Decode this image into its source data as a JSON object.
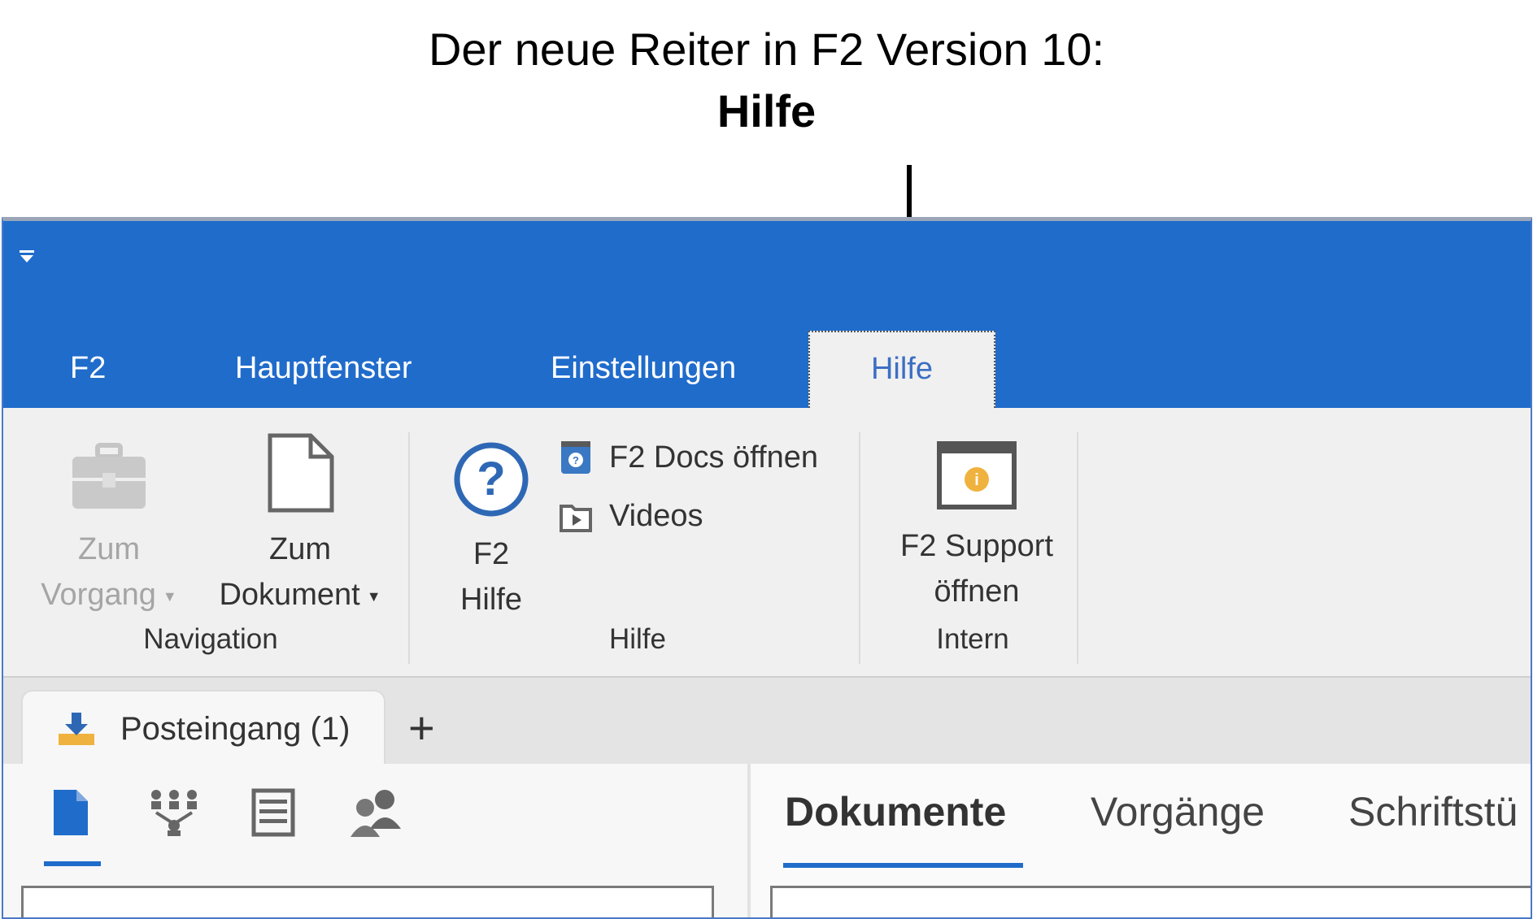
{
  "caption": {
    "line1": "Der neue Reiter in F2 Version 10:",
    "line2": "Hilfe"
  },
  "menu_tabs": [
    {
      "label": "F2"
    },
    {
      "label": "Hauptfenster"
    },
    {
      "label": "Einstellungen"
    },
    {
      "label": "Hilfe",
      "active": true
    }
  ],
  "ribbon": {
    "navigation": {
      "group_label": "Navigation",
      "zum_vorgang": {
        "line1": "Zum",
        "line2": "Vorgang"
      },
      "zum_dokument": {
        "line1": "Zum",
        "line2": "Dokument"
      }
    },
    "hilfe": {
      "group_label": "Hilfe",
      "f2_hilfe": {
        "line1": "F2",
        "line2": "Hilfe"
      },
      "docs": "F2 Docs öffnen",
      "videos": "Videos"
    },
    "intern": {
      "group_label": "Intern",
      "support": {
        "line1": "F2 Support",
        "line2": "öffnen"
      }
    }
  },
  "doc_tabs": {
    "inbox": "Posteingang (1)",
    "add": "+"
  },
  "right_tabs": [
    "Dokumente",
    "Vorgänge",
    "Schriftstü"
  ],
  "colors": {
    "titlebar": "#206ccb",
    "accent": "#206ccb",
    "active_tab_text": "#3c6fc4",
    "inbox_icon": "#f0b23e"
  },
  "icons": {
    "quick_access": "dropdown-arrow-icon",
    "zum_vorgang": "briefcase-icon",
    "zum_dokument": "document-icon",
    "f2_hilfe": "question-circle-icon",
    "docs": "help-book-icon",
    "videos": "video-folder-icon",
    "support": "info-window-icon",
    "inbox": "inbox-download-icon",
    "left_tabs": [
      "document-icon",
      "org-chart-icon",
      "list-icon",
      "users-icon"
    ]
  }
}
